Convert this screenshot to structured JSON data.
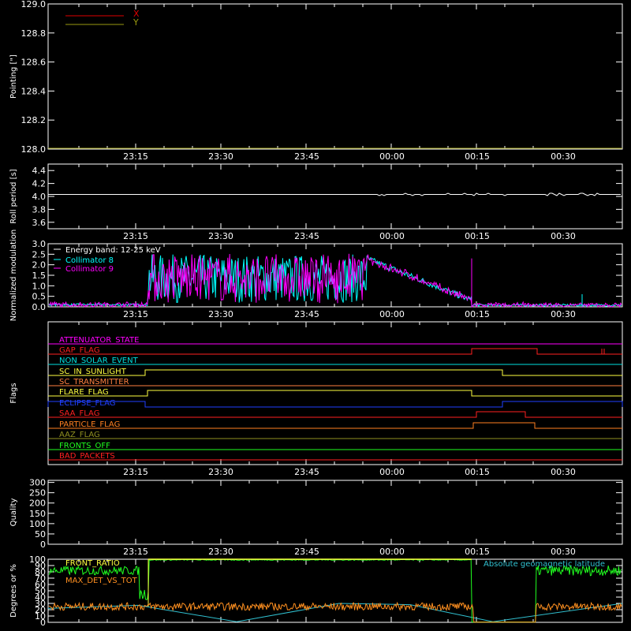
{
  "chart_data": [
    {
      "type": "line",
      "panel": "pointing",
      "ylabel": "Pointing [\"]",
      "ylim": [
        128.0,
        129.0
      ],
      "y_ticks": [
        "128.0",
        "128.2",
        "128.4",
        "128.6",
        "128.8",
        "129.0"
      ],
      "x_ticks": [
        "23:15",
        "23:30",
        "23:45",
        "00:00",
        "00:15",
        "00:30"
      ],
      "legend": [
        {
          "name": "X",
          "color": "#e00000"
        },
        {
          "name": "Y",
          "color": "#9a9a10"
        }
      ],
      "series": []
    },
    {
      "type": "line",
      "panel": "roll-period",
      "ylabel": "Roll period [s]",
      "ylim": [
        3.5,
        4.5
      ],
      "y_ticks": [
        "3.6",
        "3.8",
        "4.0",
        "4.2",
        "4.4"
      ],
      "x_ticks": [
        "23:15",
        "23:30",
        "23:45",
        "00:00",
        "00:15",
        "00:30"
      ],
      "series": [
        {
          "color": "#ffffff",
          "value": 4.03
        }
      ]
    },
    {
      "type": "line",
      "panel": "modulation",
      "ylabel": "Normalized modulation",
      "ylim": [
        0.0,
        3.0
      ],
      "y_ticks": [
        "0.0",
        "0.5",
        "1.0",
        "1.5",
        "2.0",
        "2.5",
        "3.0"
      ],
      "x_ticks": [
        "23:15",
        "23:30",
        "23:45",
        "00:00",
        "00:15",
        "00:30"
      ],
      "annotation": "Energy band: 12-25 keV",
      "series": [
        {
          "name": "Collimator 8",
          "color": "#00ffff"
        },
        {
          "name": "Collimator 9",
          "color": "#ff00ff"
        }
      ]
    },
    {
      "type": "line",
      "panel": "flags",
      "ylabel": "Flags",
      "x_ticks": [
        "23:15",
        "23:30",
        "23:45",
        "00:00",
        "00:15",
        "00:30"
      ],
      "flags": [
        {
          "name": "ATTENUATOR_STATE",
          "color": "#ff00ff"
        },
        {
          "name": "GAP_FLAG",
          "color": "#ff2020"
        },
        {
          "name": "NON_SOLAR_EVENT",
          "color": "#00e0e0"
        },
        {
          "name": "SC_IN_SUNLIGHT",
          "color": "#ffff40"
        },
        {
          "name": "SC_TRANSMITTER",
          "color": "#ff8040"
        },
        {
          "name": "FLARE_FLAG",
          "color": "#ffff40"
        },
        {
          "name": "ECLIPSE_FLAG",
          "color": "#2040ff"
        },
        {
          "name": "SAA_FLAG",
          "color": "#ff2020"
        },
        {
          "name": "PARTICLE_FLAG",
          "color": "#ff8020"
        },
        {
          "name": "AAZ_FLAG",
          "color": "#909020"
        },
        {
          "name": "FRONTS_OFF",
          "color": "#20ff20"
        },
        {
          "name": "BAD_PACKETS",
          "color": "#ff2020"
        }
      ]
    },
    {
      "type": "line",
      "panel": "quality",
      "ylabel": "Quality",
      "ylim": [
        0,
        310
      ],
      "y_ticks": [
        "0",
        "50",
        "100",
        "150",
        "200",
        "250",
        "300"
      ],
      "x_ticks": [
        "23:15",
        "23:30",
        "23:45",
        "00:00",
        "00:15",
        "00:30"
      ],
      "series": []
    },
    {
      "type": "line",
      "panel": "ratios",
      "ylabel": "Degrees or %",
      "ylim": [
        0,
        100
      ],
      "y_ticks": [
        "0",
        "10",
        "20",
        "30",
        "40",
        "50",
        "60",
        "70",
        "80",
        "90",
        "100"
      ],
      "series": [
        {
          "name": "FRONT_RATIO",
          "color": "#ffff40"
        },
        {
          "name": "MAX_DET_VS_TOT",
          "color": "#ff9020"
        },
        {
          "name": "Absolute geomagnetic latitude",
          "color": "#30c0d0"
        },
        {
          "color": "#20ff20"
        }
      ]
    }
  ]
}
